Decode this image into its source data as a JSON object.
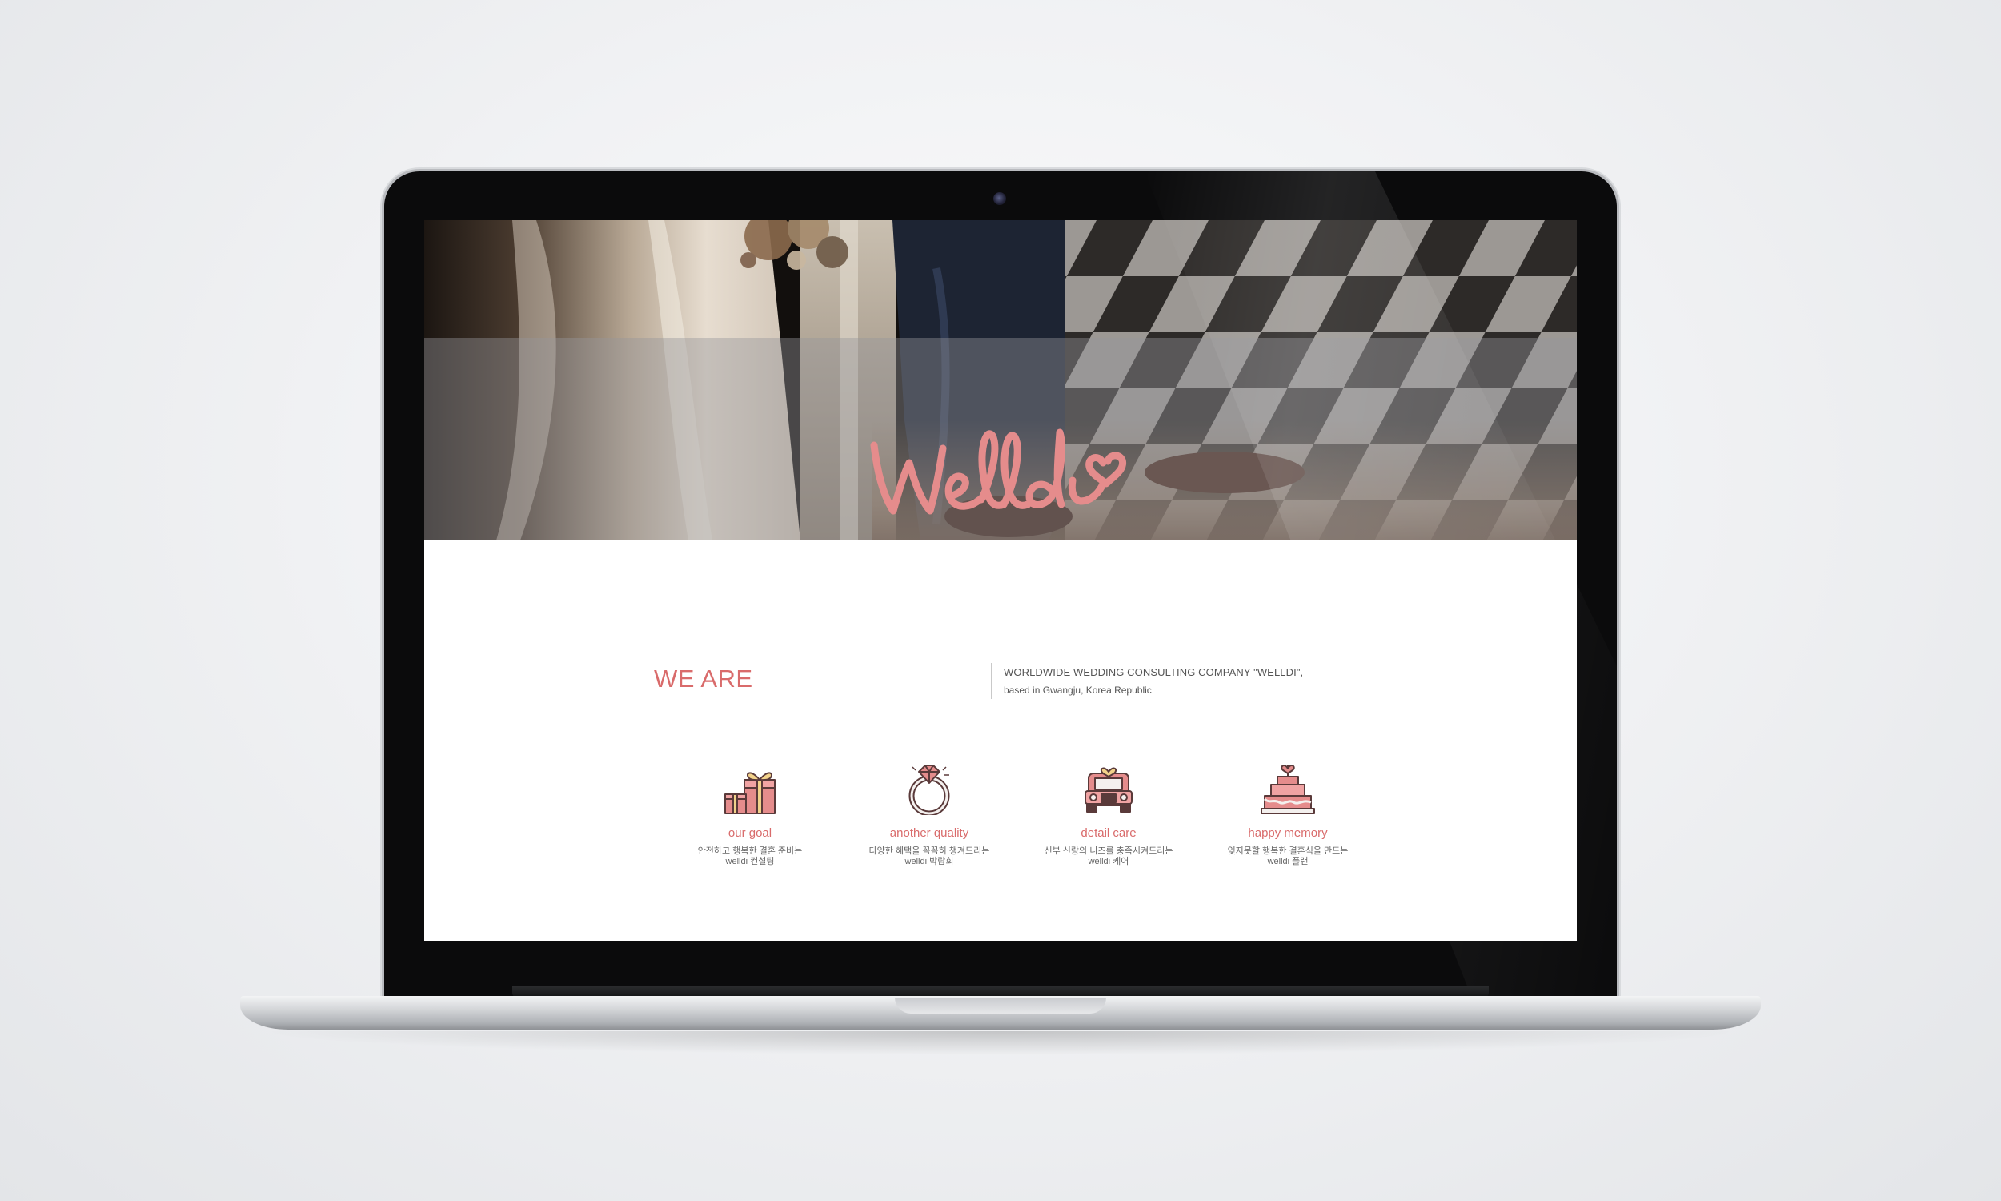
{
  "colors": {
    "accent": "#d96b6b",
    "text_muted": "#555555"
  },
  "hero": {
    "logo_text": "Welldi"
  },
  "about": {
    "heading": "WE ARE",
    "line1": "WORLDWIDE WEDDING CONSULTING COMPANY \"WELLDI\",",
    "line2": "based in Gwangju, Korea Republic"
  },
  "features": [
    {
      "icon": "gift-icon",
      "title": "our goal",
      "desc1": "안전하고 행복한 결혼 준비는",
      "desc2": "welldi 컨설팅"
    },
    {
      "icon": "diamond-ring-icon",
      "title": "another quality",
      "desc1": "다양한 혜택을 꼼꼼히 챙겨드리는",
      "desc2": "welldi 박람회"
    },
    {
      "icon": "wedding-car-icon",
      "title": "detail care",
      "desc1": "신부 신랑의 니즈를 충족시켜드리는",
      "desc2": "welldi 케어"
    },
    {
      "icon": "wedding-cake-icon",
      "title": "happy memory",
      "desc1": "잊지못할 행복한 결혼식을 만드는",
      "desc2": "welldi 플랜"
    }
  ]
}
